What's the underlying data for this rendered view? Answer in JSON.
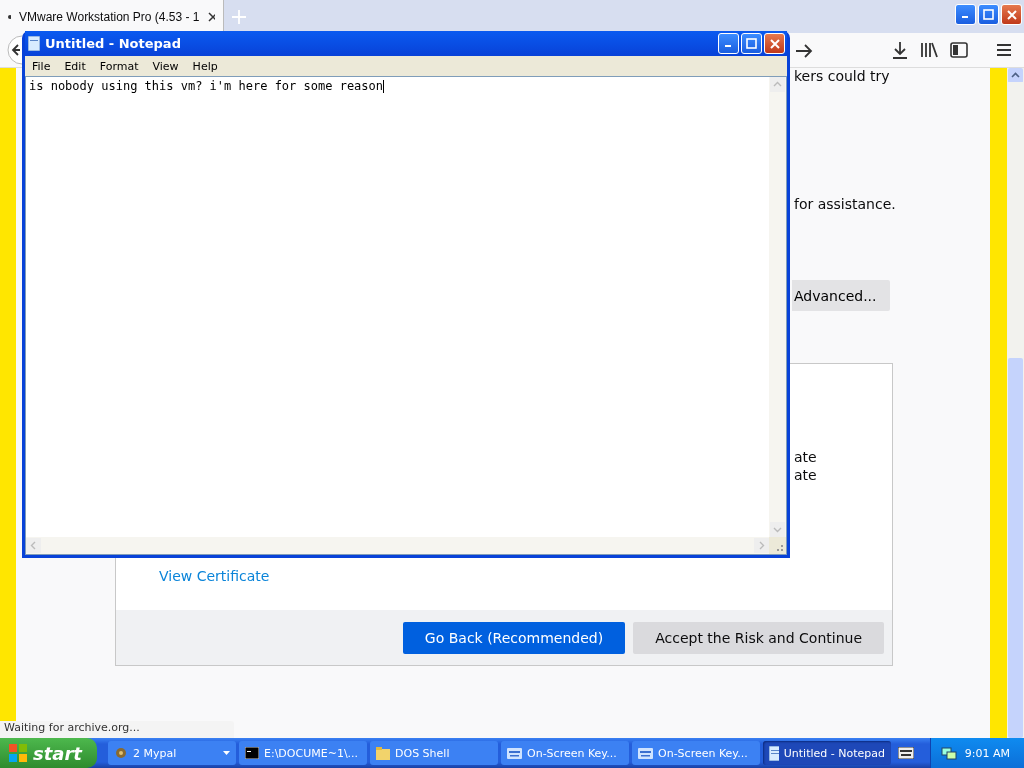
{
  "browser": {
    "tab": {
      "title": "VMware Workstation Pro (4.53 - 1"
    },
    "page": {
      "top_text": "kers could try",
      "assistance_text": "for assistance.",
      "advanced_button": "Advanced...",
      "details": {
        "lines": [
          "ate",
          "ate"
        ],
        "link": "View Certificate",
        "buttons": [
          {
            "label": "Go Back (Recommended)",
            "kind": "primary"
          },
          {
            "label": "Accept the Risk and Continue",
            "kind": "secondary"
          }
        ]
      }
    },
    "status": "Waiting for archive.org..."
  },
  "notepad": {
    "title": "Untitled - Notepad",
    "menu": [
      "File",
      "Edit",
      "Format",
      "View",
      "Help"
    ],
    "text": "is nobody using this vm? i'm here for some reason"
  },
  "taskbar": {
    "start": "start",
    "items": [
      {
        "label": "2 Mypal",
        "kind": "group",
        "selected": false
      },
      {
        "label": "E:\\DOCUME~1\\...",
        "kind": "console",
        "selected": false
      },
      {
        "label": "DOS Shell",
        "kind": "folder",
        "selected": false
      },
      {
        "label": "On-Screen Key...",
        "kind": "keyboard",
        "selected": false
      },
      {
        "label": "On-Screen Key...",
        "kind": "keyboard",
        "selected": false
      },
      {
        "label": "Untitled - Notepad",
        "kind": "notepad",
        "selected": true
      }
    ],
    "clock": "9:01 AM"
  }
}
